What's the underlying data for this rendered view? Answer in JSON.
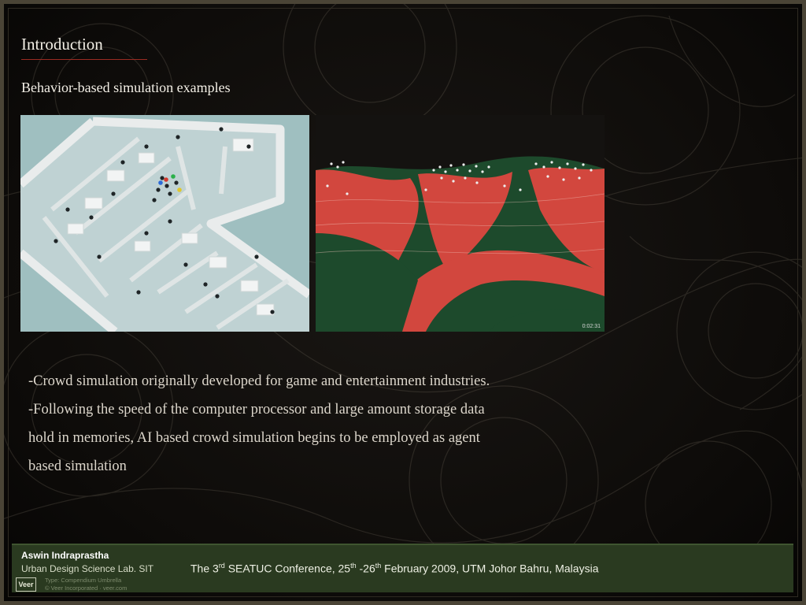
{
  "slide": {
    "title": "Introduction",
    "subtitle": "Behavior-based simulation examples"
  },
  "images": {
    "left": {
      "description_icon": "office-floorplan-crowd-image"
    },
    "right": {
      "description_icon": "terrain-crowd-image",
      "timestamp": "0:02:31"
    }
  },
  "body": {
    "lines": [
      "-Crowd simulation originally developed for game and entertainment industries.",
      "-Following the speed of the computer processor and large amount storage data",
      "hold in memories, AI based crowd simulation  begins to be employed  as agent",
      "based simulation"
    ]
  },
  "footer": {
    "author": "Aswin Indraprastha",
    "lab": "Urban Design Science Lab. SIT",
    "conference": {
      "p1": "The 3",
      "sup1": "rd",
      "p2": " SEATUC Conference, 25",
      "sup2": "th",
      "p3": " -26",
      "sup3": "th",
      "p4": "  February 2009, UTM Johor Bahru, Malaysia"
    },
    "logo_text": "Veer",
    "credit_line1": "Type: Compendium Umbrella",
    "credit_line2": "© Veer Incorporated · veer.com"
  },
  "colors": {
    "background": "#0d0b09",
    "frame": "#4a4436",
    "title_rule": "#9a2b22",
    "footer_bg": "#2a3a20",
    "terrain_red": "#d2473e",
    "terrain_green": "#1d4a2c",
    "floor": "#9fbfc0"
  }
}
